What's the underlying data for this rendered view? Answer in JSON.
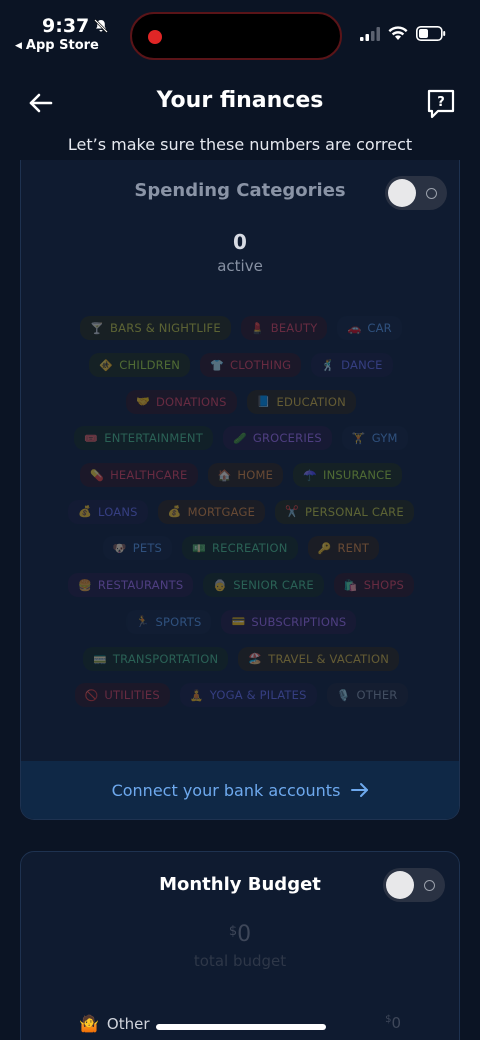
{
  "status": {
    "time": "9:37",
    "back_app": "App Store"
  },
  "header": {
    "title": "Your finances",
    "subtitle": "Let’s make sure these numbers are correct"
  },
  "spending": {
    "title": "Spending Categories",
    "count": "0",
    "count_label": "active",
    "connect_label": "Connect your bank accounts"
  },
  "categories": [
    [
      {
        "icon": "🍸",
        "label": "Bars & Nightlife",
        "color": "#c7c83a",
        "bg": "#262914"
      },
      {
        "icon": "💄",
        "label": "Beauty",
        "color": "#e0415a",
        "bg": "#2c1620"
      },
      {
        "icon": "🚗",
        "label": "Car",
        "color": "#5b9ae8",
        "bg": "#142238"
      }
    ],
    [
      {
        "icon": "🚸",
        "label": "Children",
        "color": "#a8d83a",
        "bg": "#1e2a16"
      },
      {
        "icon": "👕",
        "label": "Clothing",
        "color": "#e0415a",
        "bg": "#2c1620"
      },
      {
        "icon": "🕺",
        "label": "Dance",
        "color": "#6a6ff0",
        "bg": "#191b3a"
      }
    ],
    [
      {
        "icon": "🤝",
        "label": "Donations",
        "color": "#e0415a",
        "bg": "#2c1620"
      },
      {
        "icon": "📘",
        "label": "Education",
        "color": "#d9b43a",
        "bg": "#2a2416"
      }
    ],
    [
      {
        "icon": "🎟️",
        "label": "Entertainment",
        "color": "#4fc18a",
        "bg": "#14281f"
      },
      {
        "icon": "🥒",
        "label": "Groceries",
        "color": "#a66ff0",
        "bg": "#231a3a"
      },
      {
        "icon": "🏋️",
        "label": "Gym",
        "color": "#5b9ae8",
        "bg": "#142238"
      }
    ],
    [
      {
        "icon": "💊",
        "label": "Healthcare",
        "color": "#e0415a",
        "bg": "#2c1620"
      },
      {
        "icon": "🏠",
        "label": "Home",
        "color": "#e08a3a",
        "bg": "#2c2016"
      },
      {
        "icon": "☂️",
        "label": "Insurance",
        "color": "#a8d83a",
        "bg": "#1e2a16"
      }
    ],
    [
      {
        "icon": "💰",
        "label": "Loans",
        "color": "#6a6ff0",
        "bg": "#191b3a"
      },
      {
        "icon": "💰",
        "label": "Mortgage",
        "color": "#e08a3a",
        "bg": "#2c2016"
      },
      {
        "icon": "✂️",
        "label": "Personal Care",
        "color": "#c7c83a",
        "bg": "#262914"
      }
    ],
    [
      {
        "icon": "🐶",
        "label": "Pets",
        "color": "#5b9ae8",
        "bg": "#142238"
      },
      {
        "icon": "💵",
        "label": "Recreation",
        "color": "#4fc18a",
        "bg": "#14281f"
      },
      {
        "icon": "🔑",
        "label": "Rent",
        "color": "#e08a3a",
        "bg": "#2c2016"
      }
    ],
    [
      {
        "icon": "🍔",
        "label": "Restaurants",
        "color": "#a66ff0",
        "bg": "#231a3a"
      },
      {
        "icon": "👵",
        "label": "Senior Care",
        "color": "#4fc18a",
        "bg": "#14281f"
      },
      {
        "icon": "🛍️",
        "label": "Shops",
        "color": "#e0415a",
        "bg": "#2c1620"
      }
    ],
    [
      {
        "icon": "🏃",
        "label": "Sports",
        "color": "#5b9ae8",
        "bg": "#142238"
      },
      {
        "icon": "💳",
        "label": "Subscriptions",
        "color": "#a66ff0",
        "bg": "#231a3a"
      }
    ],
    [
      {
        "icon": "🚃",
        "label": "Transportation",
        "color": "#4fc18a",
        "bg": "#14281f"
      },
      {
        "icon": "🏖️",
        "label": "Travel & Vacation",
        "color": "#d9b43a",
        "bg": "#2a2416"
      }
    ],
    [
      {
        "icon": "🚫",
        "label": "Utilities",
        "color": "#e0415a",
        "bg": "#2c1620"
      },
      {
        "icon": "🧘",
        "label": "Yoga & Pilates",
        "color": "#6a6ff0",
        "bg": "#191b3a"
      },
      {
        "icon": "🎙️",
        "label": "Other",
        "color": "#8a94a6",
        "bg": "#1c2230"
      }
    ]
  ],
  "budget": {
    "title": "Monthly Budget",
    "currency": "$",
    "amount": "0",
    "label": "total budget",
    "other_icon": "🤷",
    "other_label": "Other",
    "other_currency": "$",
    "other_value": "0"
  },
  "colors": {
    "background": "#0b1424",
    "card": "#0f1b30",
    "accent_link": "#6ea9ee"
  }
}
